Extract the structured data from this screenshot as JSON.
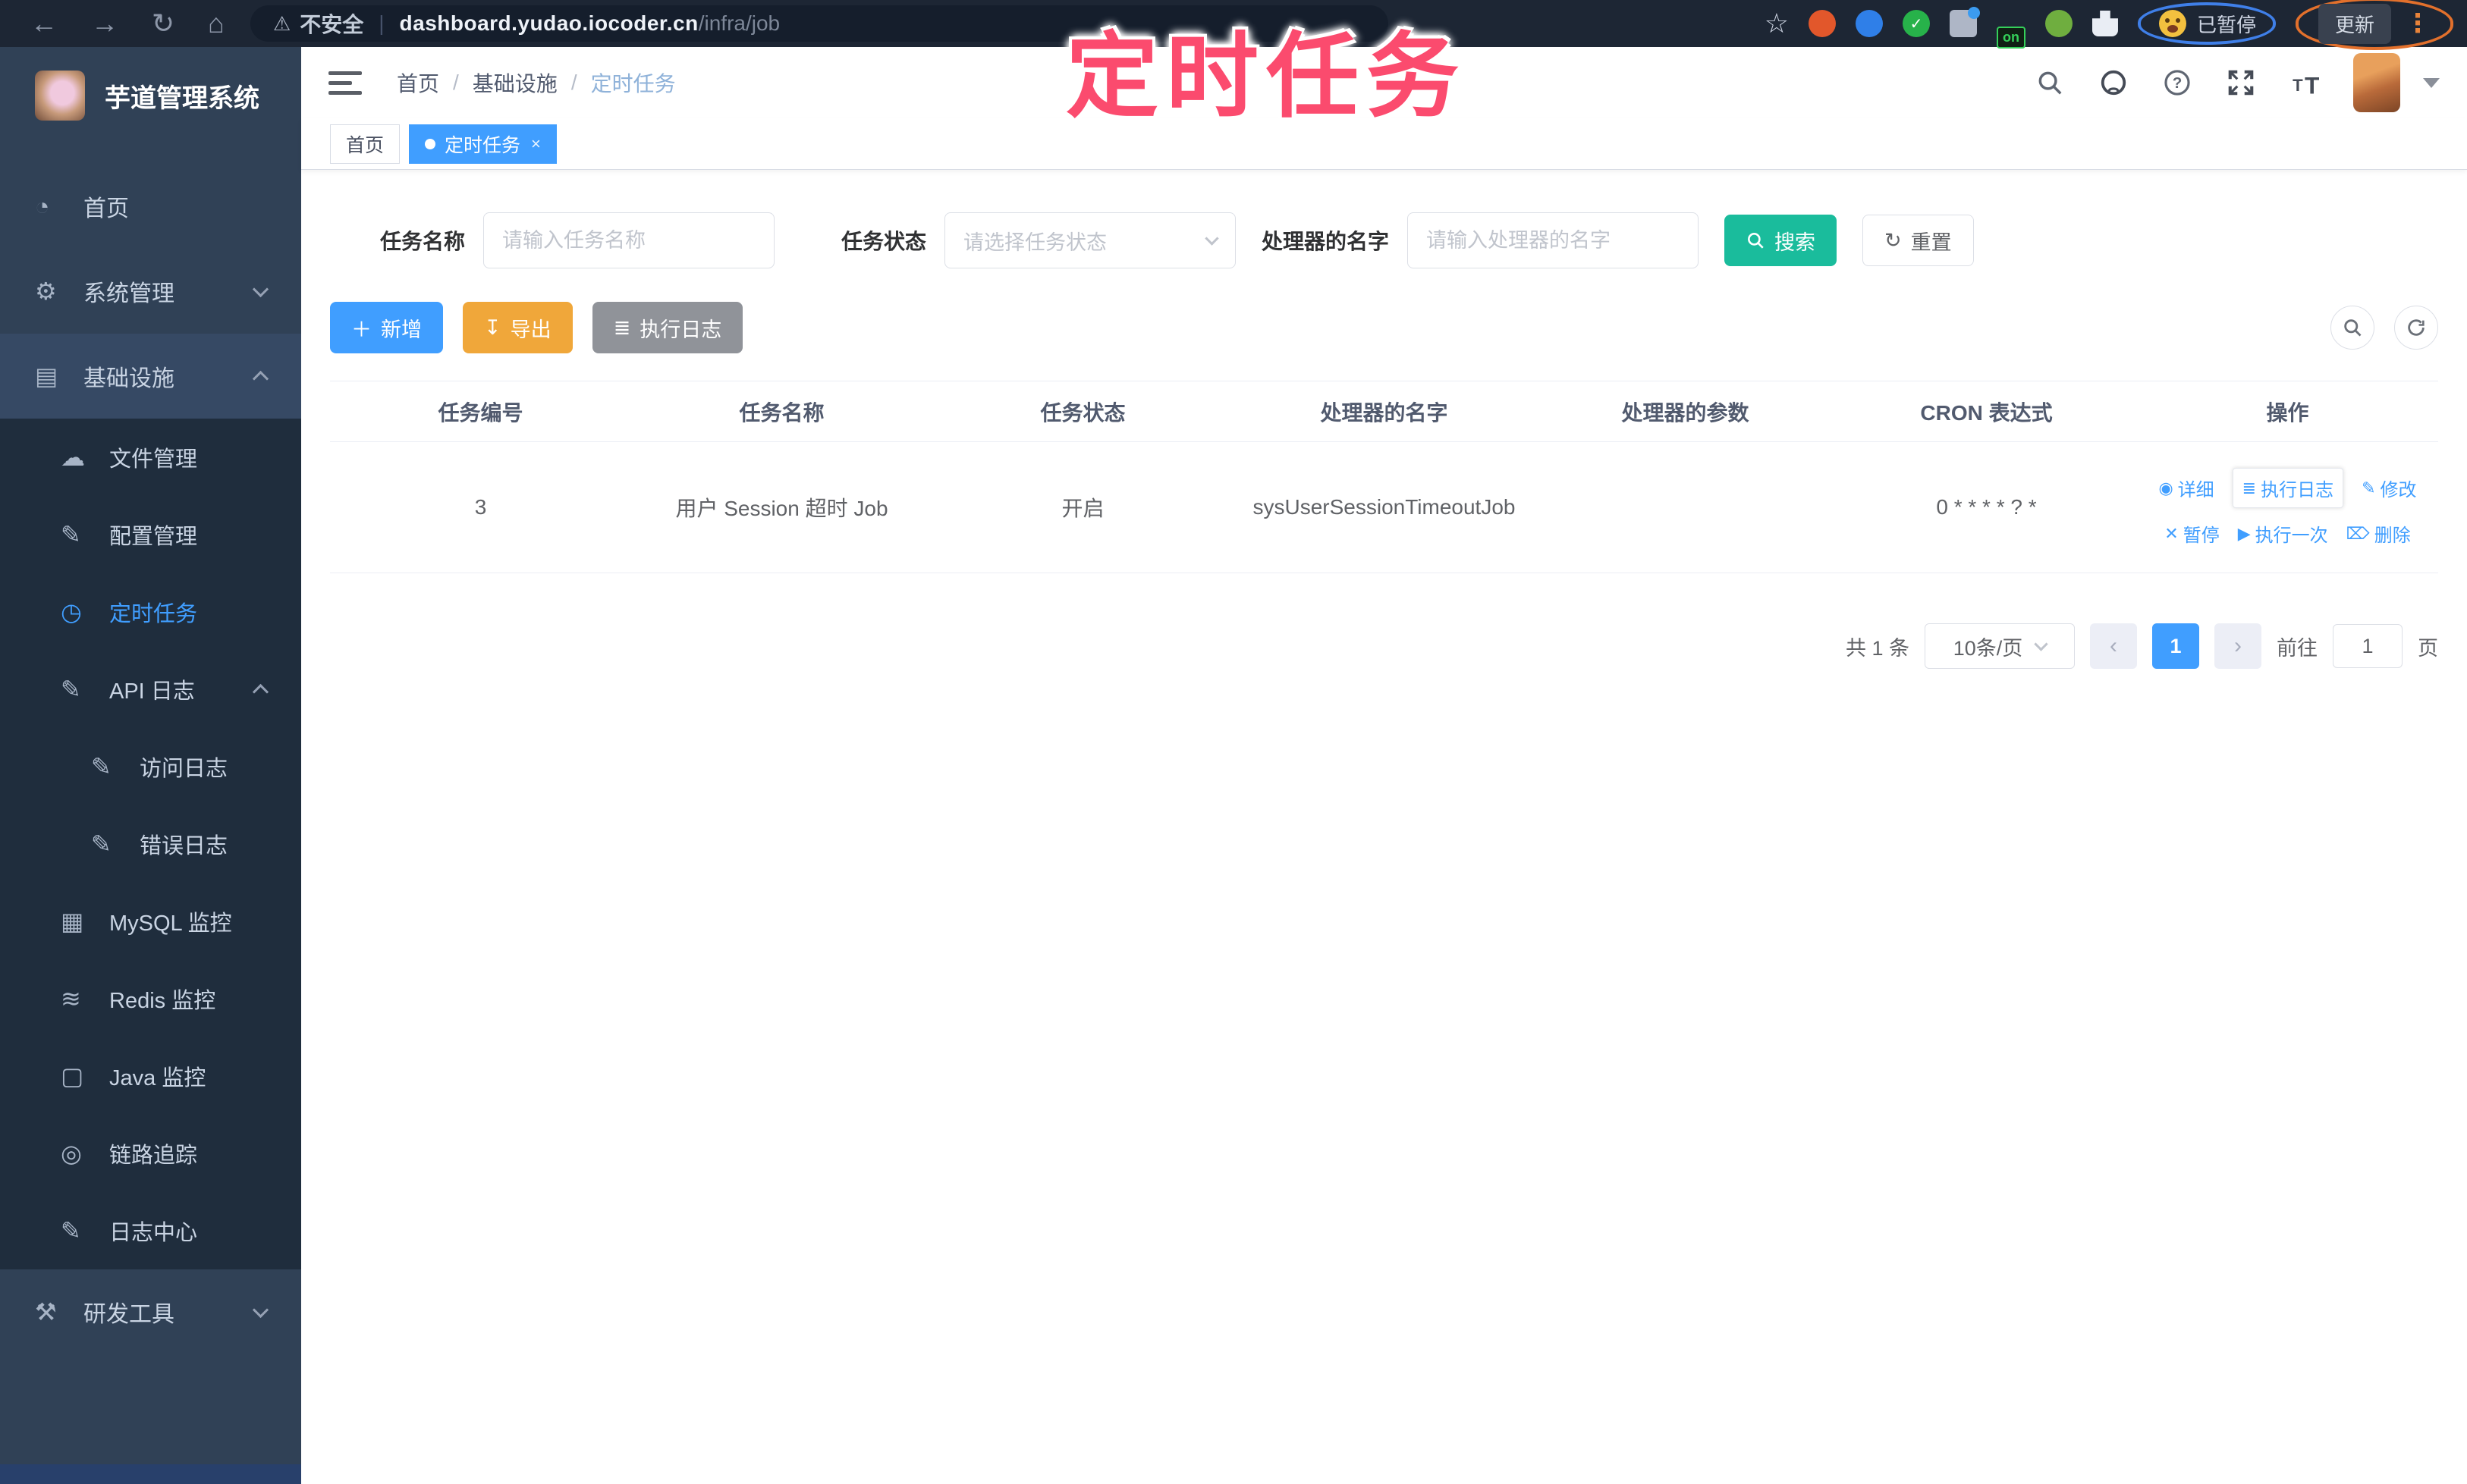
{
  "browser": {
    "nav": {
      "back": "←",
      "forward": "→",
      "reload": "↻",
      "home": "⌂"
    },
    "warning_icon": "⚠",
    "security_label": "不安全",
    "url_host": "dashboard.yudao.iocoder.cn",
    "url_path": "/infra/job",
    "on_badge": "on",
    "paused_badge": "已暂停",
    "update_button": "更新",
    "kebab_icon": "⋮",
    "star_icon": "☆"
  },
  "annotation": {
    "text": "定时任务"
  },
  "sidebar": {
    "logo_title": "芋道管理系统",
    "items": [
      {
        "icon": "◔",
        "label": "首页"
      },
      {
        "icon": "⚙",
        "label": "系统管理"
      },
      {
        "icon": "▤",
        "label": "基础设施"
      },
      {
        "icon": "☁",
        "label": "文件管理"
      },
      {
        "icon": "✎",
        "label": "配置管理"
      },
      {
        "icon": "◷",
        "label": "定时任务"
      },
      {
        "icon": "✎",
        "label": "API 日志"
      },
      {
        "icon": "✎",
        "label": "访问日志"
      },
      {
        "icon": "✎",
        "label": "错误日志"
      },
      {
        "icon": "▦",
        "label": "MySQL 监控"
      },
      {
        "icon": "≋",
        "label": "Redis 监控"
      },
      {
        "icon": "▢",
        "label": "Java 监控"
      },
      {
        "icon": "◎",
        "label": "链路追踪"
      },
      {
        "icon": "✎",
        "label": "日志中心"
      },
      {
        "icon": "⚒",
        "label": "研发工具"
      }
    ]
  },
  "header": {
    "breadcrumb": [
      "首页",
      "基础设施",
      "定时任务"
    ],
    "separator": "/"
  },
  "tabs": {
    "home": "首页",
    "current": "定时任务",
    "close_icon": "×"
  },
  "search": {
    "job_name_label": "任务名称",
    "job_name_placeholder": "请输入任务名称",
    "job_status_label": "任务状态",
    "job_status_placeholder": "请选择任务状态",
    "handler_label": "处理器的名字",
    "handler_placeholder": "请输入处理器的名字",
    "search_button": "搜索",
    "reset_button": "重置",
    "reset_icon": "↻"
  },
  "toolbar": {
    "add_button": "新增",
    "add_icon": "＋",
    "export_button": "导出",
    "export_icon": "↧",
    "log_button": "执行日志",
    "log_icon": "≣"
  },
  "table": {
    "columns": [
      "任务编号",
      "任务名称",
      "任务状态",
      "处理器的名字",
      "处理器的参数",
      "CRON 表达式",
      "操作"
    ],
    "op_icons": {
      "detail": "◉",
      "log": "≣",
      "edit": "✎",
      "pause": "✕",
      "run": "▶",
      "delete": "⌦"
    },
    "rows": [
      {
        "id": "3",
        "name": "用户 Session 超时 Job",
        "status": "开启",
        "handler": "sysUserSessionTimeoutJob",
        "param": "",
        "cron": "0 * * * * ? *",
        "op_detail": "详细",
        "op_log": "执行日志",
        "op_edit": "修改",
        "op_pause": "暂停",
        "op_run": "执行一次",
        "op_delete": "删除"
      }
    ]
  },
  "pagination": {
    "total": "共 1 条",
    "page_size": "10条/页",
    "prev_icon": "‹",
    "next_icon": "›",
    "current_page": "1",
    "goto_label": "前往",
    "goto_value": "1",
    "page_suffix": "页"
  },
  "colors": {
    "accent_blue": "#409eff",
    "search_teal": "#1abc9c",
    "export_orange": "#f0a73a",
    "annotation_pink": "#fb4b6e",
    "sidebar_bg": "#304156",
    "submenu_bg": "#1f2d3d"
  }
}
